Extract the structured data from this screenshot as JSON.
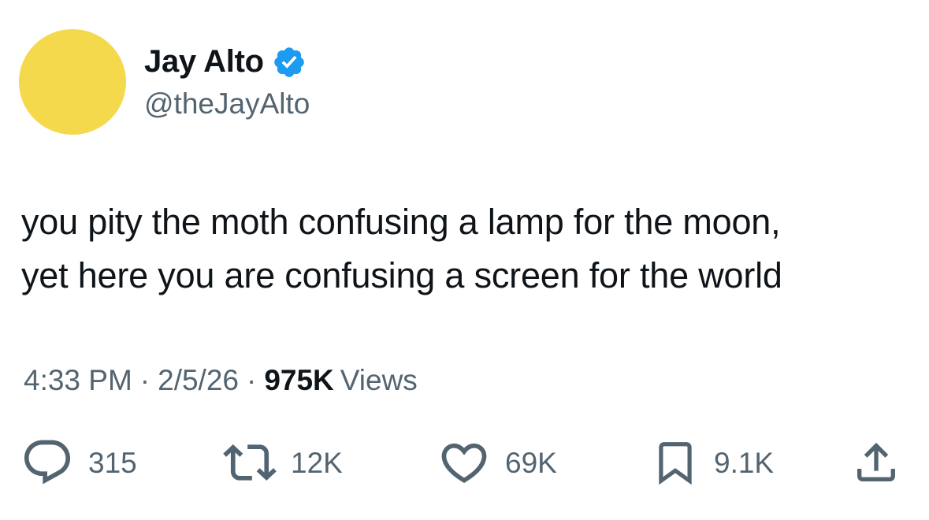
{
  "author": {
    "name": "Jay Alto",
    "handle": "@theJayAlto",
    "avatar_color": "#f5d94c",
    "verified_badge_color": "#1d9bf0"
  },
  "tweet": {
    "line1": "you pity the moth confusing a lamp for the moon,",
    "line2": "yet here you are confusing a screen for the world"
  },
  "meta": {
    "time": "4:33 PM",
    "separator": "·",
    "date": "2/5/26",
    "views_count": "975K",
    "views_label": "Views"
  },
  "actions": {
    "replies": "315",
    "retweets": "12K",
    "likes": "69K",
    "bookmarks": "9.1K"
  },
  "icons": {
    "reply": "reply-icon",
    "retweet": "retweet-icon",
    "like": "heart-icon",
    "bookmark": "bookmark-icon",
    "share": "share-icon",
    "verified": "verified-badge-icon"
  },
  "colors": {
    "text_primary": "#0f1419",
    "text_secondary": "#536471"
  }
}
